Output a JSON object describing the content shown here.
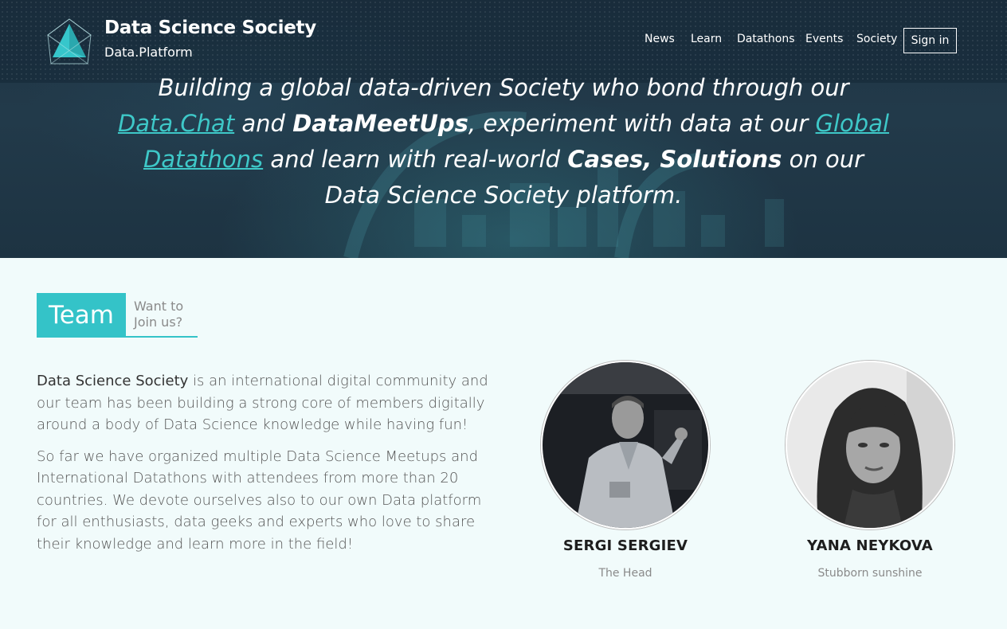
{
  "brand": {
    "title": "Data Science Society",
    "subtitle": "Data.Platform"
  },
  "nav": {
    "items": [
      "News",
      "Learn",
      "Datathons",
      "Events",
      "Society"
    ],
    "signin_label": "Sign in"
  },
  "hero": {
    "line1": "Building a global data-driven Society who bond through our",
    "link_datachat": "Data.Chat",
    "and1": " and ",
    "datameetups": "DataMeetUps",
    "experiment": ", experiment with data at our ",
    "link_global_datathons": "Global Datathons",
    "learn_with": " and learn with real-world ",
    "cases": "Cases",
    "comma": ", ",
    "solutions": "Solutions",
    "on_our": " on our",
    "platform": "Data Science Society platform."
  },
  "team": {
    "heading": "Team",
    "join_label": "Want to Join us?",
    "about_org": "Data Science Society",
    "about_p1_rest": " is an international digital community and our team has been building a strong core of members digitally around a body of Data Science knowledge while having fun!",
    "about_p2": "So far we have organized multiple Data Science Meetups and International Datathons with attendees from more than 20 countries. We devote ourselves also to our own Data platform for all enthusiasts, data geeks and experts who love to share their knowledge and learn more in the field!",
    "members": [
      {
        "name": "SERGI SERGIEV",
        "role": "The Head"
      },
      {
        "name": "YANA NEYKOVA",
        "role": "Stubborn sunshine"
      }
    ]
  },
  "colors": {
    "accent": "#34c3c8",
    "hero_bg": "#1f3444"
  }
}
